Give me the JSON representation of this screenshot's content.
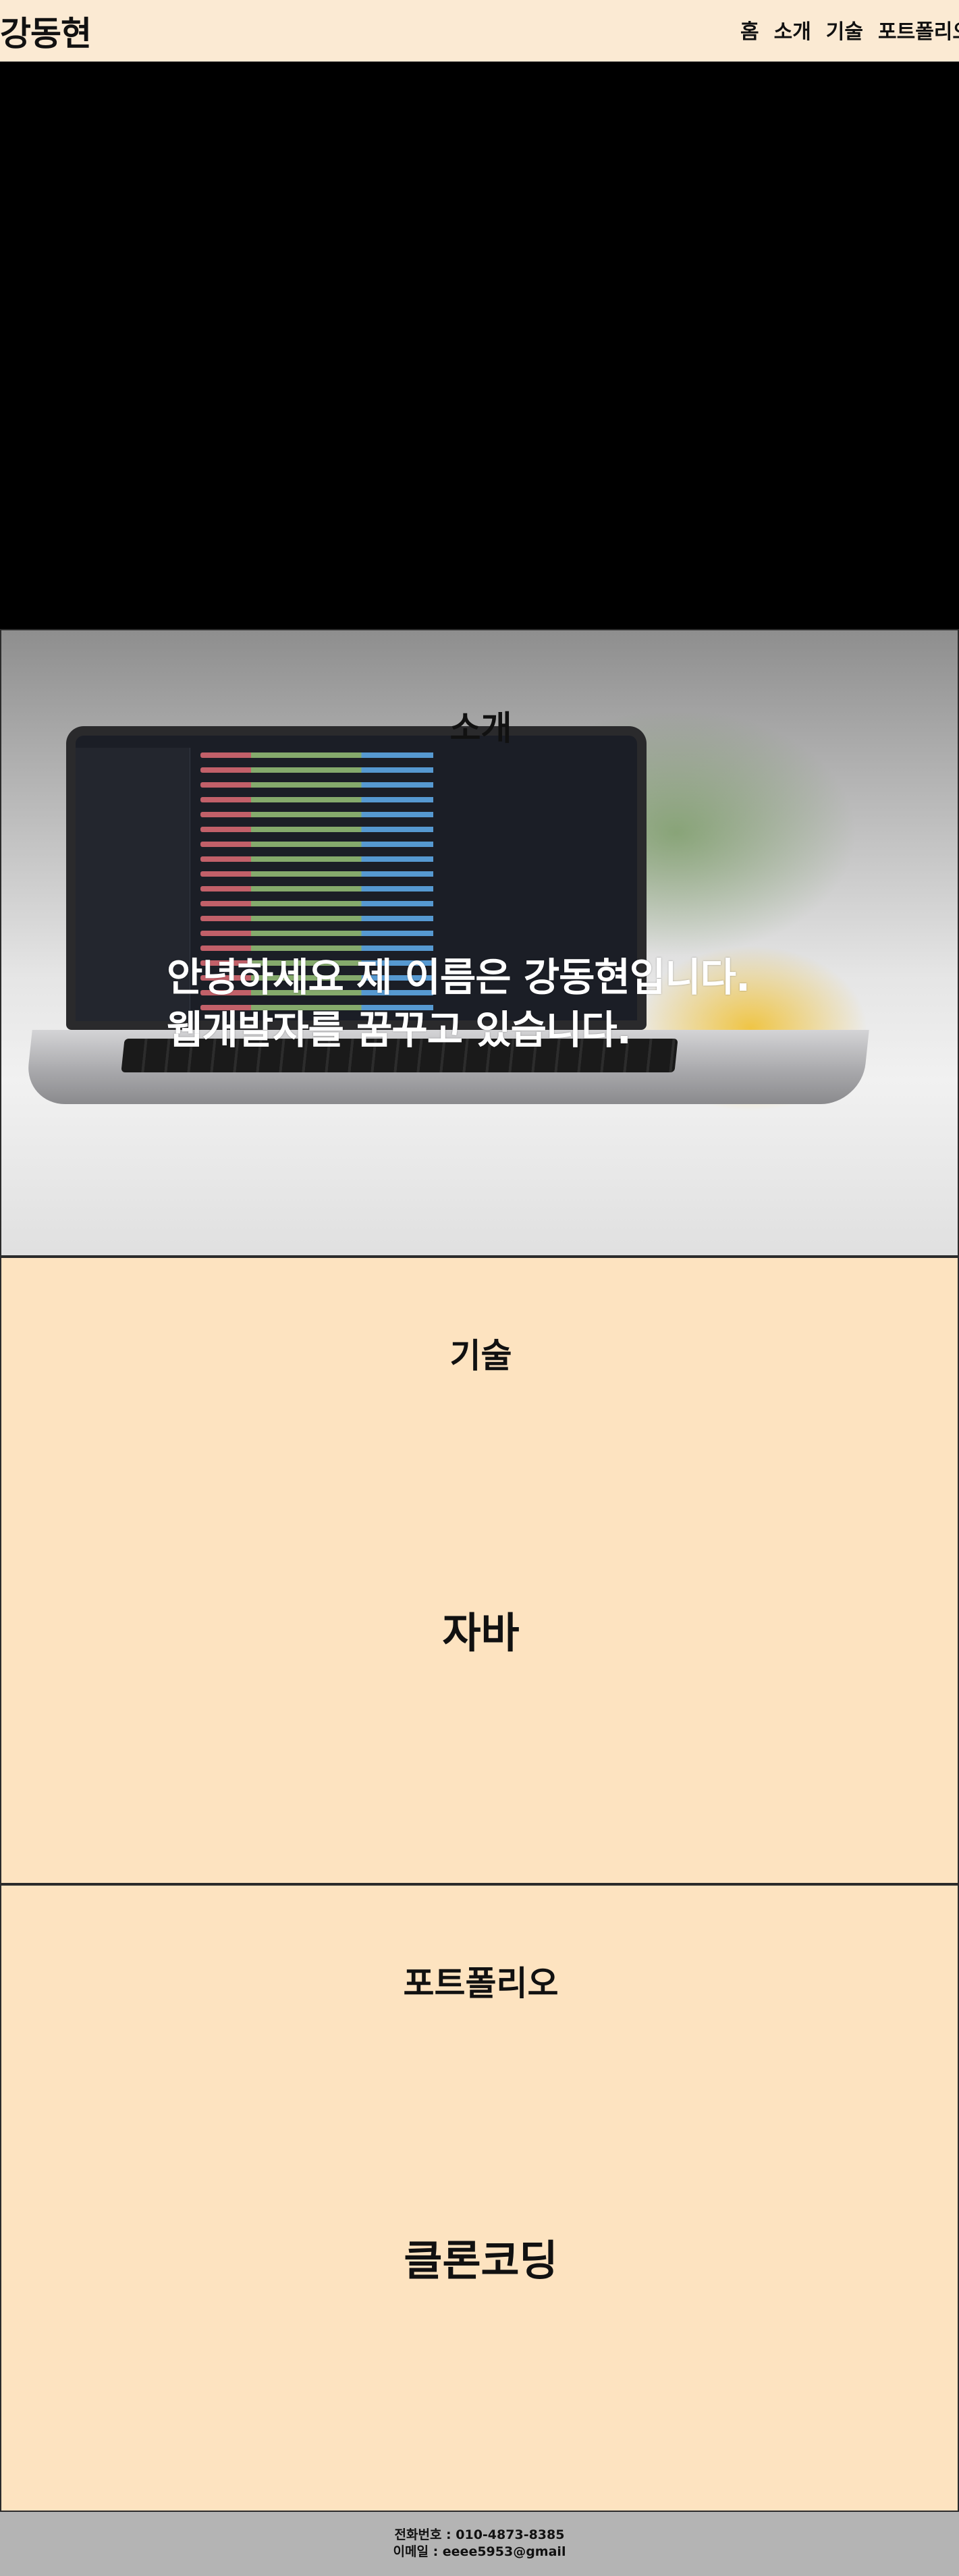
{
  "header": {
    "logo": "강동현",
    "nav": [
      "홈",
      "소개",
      "기술",
      "포트폴리오"
    ]
  },
  "about": {
    "title": "소개",
    "intro_line1": "안녕하세요 제 이름은 강동현입니다.",
    "intro_line2": "웹개발자를 꿈꾸고 있습니다."
  },
  "skills": {
    "title": "기술",
    "item": "자바"
  },
  "portfolio": {
    "title": "포트폴리오",
    "item": "클론코딩"
  },
  "footer": {
    "phone": "전화번호 : 010-4873-8385",
    "email": "이메일 : eeee5953@gmail"
  },
  "colors": {
    "header_bg": "#fbead3",
    "section_bg": "#fde3c0",
    "footer_bg": "#b4b4b4",
    "hero_bg": "#000000"
  }
}
